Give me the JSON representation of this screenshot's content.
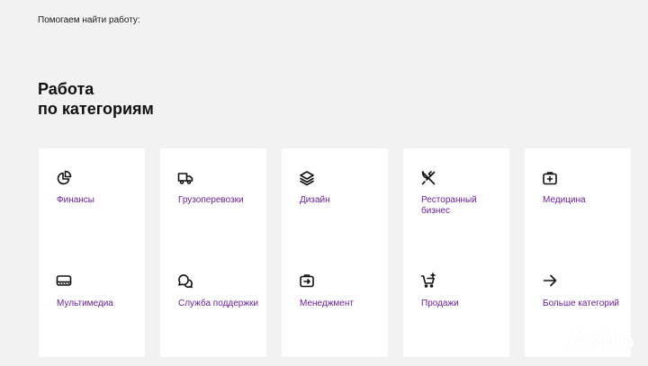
{
  "top_label": "Помогаем найти работу:",
  "heading": {
    "line1": "Работа",
    "line2": "по категориям"
  },
  "accent_color": "#6b1f9e",
  "categories": [
    {
      "label": "Финансы",
      "icon": "pie-chart-icon"
    },
    {
      "label": "Грузоперевозки",
      "icon": "truck-icon"
    },
    {
      "label": "Дизайн",
      "icon": "layers-icon"
    },
    {
      "label": "Ресторанный бизнес",
      "icon": "fork-knife-icon"
    },
    {
      "label": "Медицина",
      "icon": "medical-kit-icon"
    },
    {
      "label": "Мультимедиа",
      "icon": "multimedia-icon"
    },
    {
      "label": "Служба поддержки",
      "icon": "chat-bubbles-icon"
    },
    {
      "label": "Менеджмент",
      "icon": "briefcase-arrow-icon"
    },
    {
      "label": "Продажи",
      "icon": "cart-plus-icon"
    },
    {
      "label": "Больше категорий",
      "icon": "arrow-right-icon"
    }
  ],
  "watermark": "Avito"
}
